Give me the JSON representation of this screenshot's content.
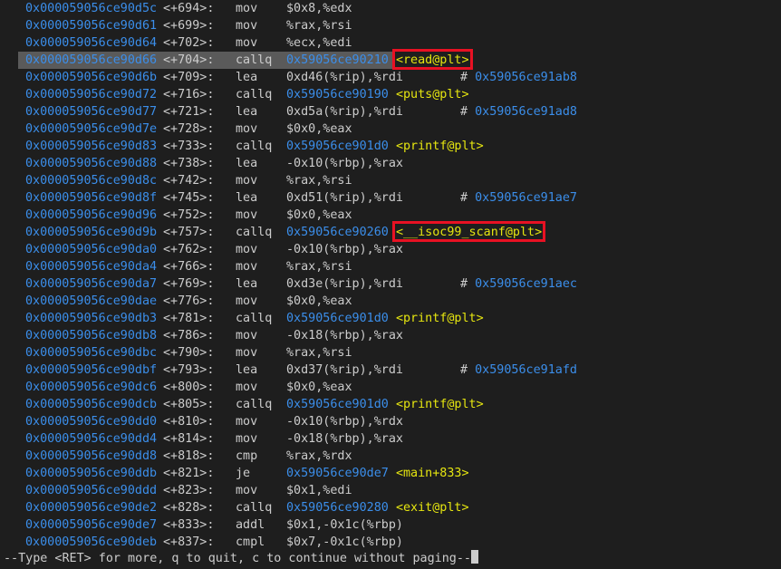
{
  "lines": [
    {
      "addr": "0x000059056ce90d5c",
      "off": "<+694>:",
      "mnem": "mov",
      "ops": "$0x8,%edx"
    },
    {
      "addr": "0x000059056ce90d61",
      "off": "<+699>:",
      "mnem": "mov",
      "ops": "%rax,%rsi"
    },
    {
      "addr": "0x000059056ce90d64",
      "off": "<+702>:",
      "mnem": "mov",
      "ops": "%ecx,%edi"
    },
    {
      "addr": "0x000059056ce90d66",
      "off": "<+704>:",
      "mnem": "callq",
      "target": "0x59056ce90210",
      "sym": "<read@plt>",
      "highlight": true,
      "boxed": true
    },
    {
      "addr": "0x000059056ce90d6b",
      "off": "<+709>:",
      "mnem": "lea",
      "ops": "0xd46(%rip),%rdi",
      "comment_hash": "#",
      "comment": "0x59056ce91ab8"
    },
    {
      "addr": "0x000059056ce90d72",
      "off": "<+716>:",
      "mnem": "callq",
      "target": "0x59056ce90190",
      "sym": "<puts@plt>"
    },
    {
      "addr": "0x000059056ce90d77",
      "off": "<+721>:",
      "mnem": "lea",
      "ops": "0xd5a(%rip),%rdi",
      "comment_hash": "#",
      "comment": "0x59056ce91ad8"
    },
    {
      "addr": "0x000059056ce90d7e",
      "off": "<+728>:",
      "mnem": "mov",
      "ops": "$0x0,%eax"
    },
    {
      "addr": "0x000059056ce90d83",
      "off": "<+733>:",
      "mnem": "callq",
      "target": "0x59056ce901d0",
      "sym": "<printf@plt>"
    },
    {
      "addr": "0x000059056ce90d88",
      "off": "<+738>:",
      "mnem": "lea",
      "ops": "-0x10(%rbp),%rax"
    },
    {
      "addr": "0x000059056ce90d8c",
      "off": "<+742>:",
      "mnem": "mov",
      "ops": "%rax,%rsi"
    },
    {
      "addr": "0x000059056ce90d8f",
      "off": "<+745>:",
      "mnem": "lea",
      "ops": "0xd51(%rip),%rdi",
      "comment_hash": "#",
      "comment": "0x59056ce91ae7"
    },
    {
      "addr": "0x000059056ce90d96",
      "off": "<+752>:",
      "mnem": "mov",
      "ops": "$0x0,%eax"
    },
    {
      "addr": "0x000059056ce90d9b",
      "off": "<+757>:",
      "mnem": "callq",
      "target": "0x59056ce90260",
      "sym": "<__isoc99_scanf@plt>",
      "boxed": true
    },
    {
      "addr": "0x000059056ce90da0",
      "off": "<+762>:",
      "mnem": "mov",
      "ops": "-0x10(%rbp),%rax"
    },
    {
      "addr": "0x000059056ce90da4",
      "off": "<+766>:",
      "mnem": "mov",
      "ops": "%rax,%rsi"
    },
    {
      "addr": "0x000059056ce90da7",
      "off": "<+769>:",
      "mnem": "lea",
      "ops": "0xd3e(%rip),%rdi",
      "comment_hash": "#",
      "comment": "0x59056ce91aec"
    },
    {
      "addr": "0x000059056ce90dae",
      "off": "<+776>:",
      "mnem": "mov",
      "ops": "$0x0,%eax"
    },
    {
      "addr": "0x000059056ce90db3",
      "off": "<+781>:",
      "mnem": "callq",
      "target": "0x59056ce901d0",
      "sym": "<printf@plt>"
    },
    {
      "addr": "0x000059056ce90db8",
      "off": "<+786>:",
      "mnem": "mov",
      "ops": "-0x18(%rbp),%rax"
    },
    {
      "addr": "0x000059056ce90dbc",
      "off": "<+790>:",
      "mnem": "mov",
      "ops": "%rax,%rsi"
    },
    {
      "addr": "0x000059056ce90dbf",
      "off": "<+793>:",
      "mnem": "lea",
      "ops": "0xd37(%rip),%rdi",
      "comment_hash": "#",
      "comment": "0x59056ce91afd"
    },
    {
      "addr": "0x000059056ce90dc6",
      "off": "<+800>:",
      "mnem": "mov",
      "ops": "$0x0,%eax"
    },
    {
      "addr": "0x000059056ce90dcb",
      "off": "<+805>:",
      "mnem": "callq",
      "target": "0x59056ce901d0",
      "sym": "<printf@plt>"
    },
    {
      "addr": "0x000059056ce90dd0",
      "off": "<+810>:",
      "mnem": "mov",
      "ops": "-0x10(%rbp),%rdx"
    },
    {
      "addr": "0x000059056ce90dd4",
      "off": "<+814>:",
      "mnem": "mov",
      "ops": "-0x18(%rbp),%rax"
    },
    {
      "addr": "0x000059056ce90dd8",
      "off": "<+818>:",
      "mnem": "cmp",
      "ops": "%rax,%rdx"
    },
    {
      "addr": "0x000059056ce90ddb",
      "off": "<+821>:",
      "mnem": "je",
      "target": "0x59056ce90de7",
      "sym": "<main+833>"
    },
    {
      "addr": "0x000059056ce90ddd",
      "off": "<+823>:",
      "mnem": "mov",
      "ops": "$0x1,%edi"
    },
    {
      "addr": "0x000059056ce90de2",
      "off": "<+828>:",
      "mnem": "callq",
      "target": "0x59056ce90280",
      "sym": "<exit@plt>"
    },
    {
      "addr": "0x000059056ce90de7",
      "off": "<+833>:",
      "mnem": "addl",
      "ops": "$0x1,-0x1c(%rbp)"
    },
    {
      "addr": "0x000059056ce90deb",
      "off": "<+837>:",
      "mnem": "cmpl",
      "ops": "$0x7,-0x1c(%rbp)"
    }
  ],
  "prompt": "--Type <RET> for more, q to quit, c to continue without paging--",
  "colors": {
    "background": "#1e1e1e",
    "address": "#3b8eea",
    "symbol": "#e5e510",
    "text": "#cccccc",
    "annotation_box": "#e81123",
    "current_line_highlight": "#5a5a5a"
  }
}
